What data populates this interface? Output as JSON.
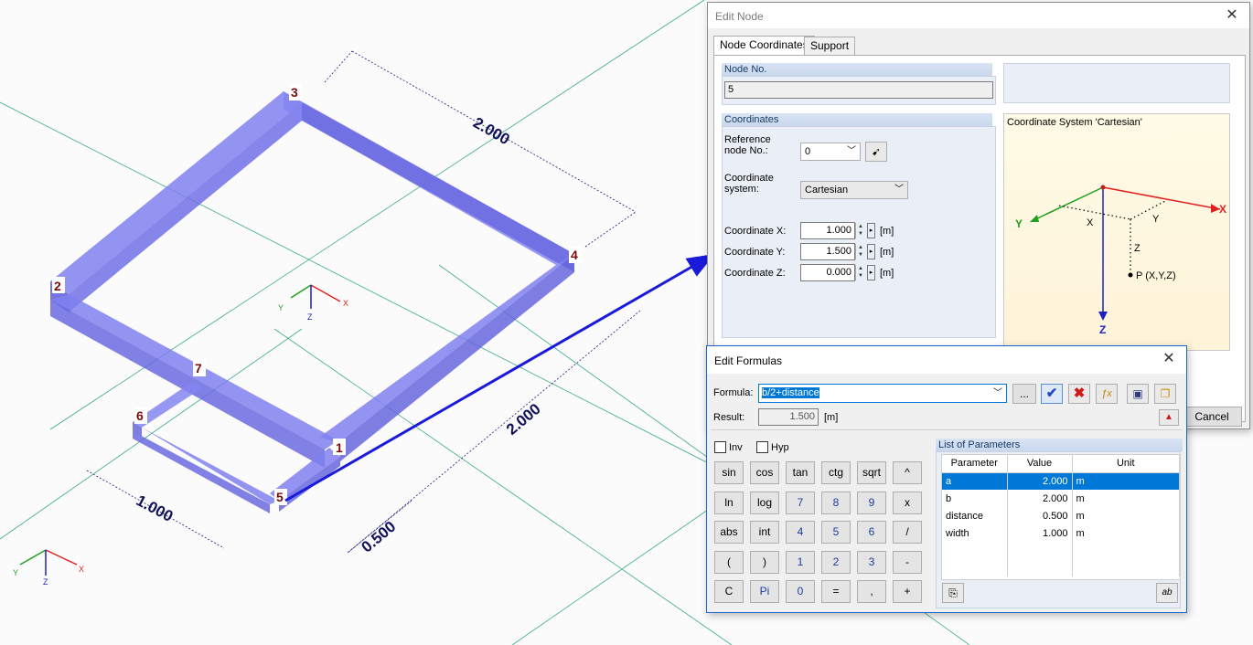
{
  "model": {
    "nodes": [
      "1",
      "2",
      "3",
      "4",
      "5",
      "6",
      "7"
    ],
    "dims": {
      "d_top": "2.000",
      "d_right": "2.000",
      "d_width": "1.000",
      "d_dist": "0.500"
    },
    "axes": {
      "x": "X",
      "y": "Y",
      "z": "Z"
    },
    "colors": {
      "beam": "#6a6ae0",
      "arrow": "#1a1adb",
      "axisX": "#e02020",
      "axisY": "#20a020",
      "axisZ": "#2020c0"
    }
  },
  "edit_node": {
    "title": "Edit Node",
    "tabs": [
      "Node Coordinates",
      "Support"
    ],
    "node_no_label": "Node No.",
    "node_no_value": "5",
    "coordinates_label": "Coordinates",
    "ref_node_label1": "Reference",
    "ref_node_label2": "node No.:",
    "ref_node_value": "0",
    "coord_sys_label1": "Coordinate",
    "coord_sys_label2": "system:",
    "coord_sys_value": "Cartesian",
    "coord_x_label": "Coordinate X:",
    "coord_x_value": "1.000",
    "coord_y_label": "Coordinate Y:",
    "coord_y_value": "1.500",
    "coord_z_label": "Coordinate Z:",
    "coord_z_value": "0.000",
    "unit": "[m]",
    "preview_title": "Coordinate System 'Cartesian'",
    "preview_point": "P (X,Y,Z)",
    "cancel_label": "Cancel"
  },
  "edit_formulas": {
    "title": "Edit Formulas",
    "formula_label": "Formula:",
    "formula_value": "b/2+distance",
    "result_label": "Result:",
    "result_value": "1.500",
    "result_unit": "[m]",
    "more_label": "...",
    "inv_label": "Inv",
    "hyp_label": "Hyp",
    "list_title": "List of Parameters",
    "columns": [
      "Parameter",
      "Value",
      "Unit"
    ],
    "params": [
      {
        "name": "a",
        "value": "2.000",
        "unit": "m"
      },
      {
        "name": "b",
        "value": "2.000",
        "unit": "m"
      },
      {
        "name": "distance",
        "value": "0.500",
        "unit": "m"
      },
      {
        "name": "width",
        "value": "1.000",
        "unit": "m"
      }
    ],
    "keys": [
      [
        "sin",
        "cos",
        "tan",
        "ctg",
        "sqrt",
        "^"
      ],
      [
        "ln",
        "log",
        "7",
        "8",
        "9",
        "x"
      ],
      [
        "abs",
        "int",
        "4",
        "5",
        "6",
        "/"
      ],
      [
        "(",
        ")",
        "1",
        "2",
        "3",
        "-"
      ],
      [
        "C",
        "Pi",
        "0",
        "=",
        ",",
        "+"
      ]
    ]
  }
}
